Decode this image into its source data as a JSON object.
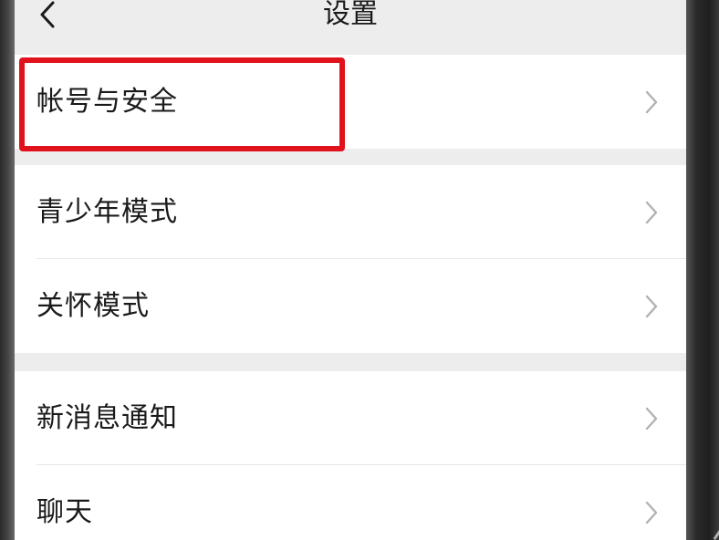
{
  "header": {
    "title": "设置",
    "back_icon": "chevron-left-icon"
  },
  "groups": [
    {
      "items": [
        {
          "label": "帐号与安全"
        }
      ]
    },
    {
      "items": [
        {
          "label": "青少年模式"
        },
        {
          "label": "关怀模式"
        }
      ]
    },
    {
      "items": [
        {
          "label": "新消息通知"
        },
        {
          "label": "聊天"
        }
      ]
    }
  ],
  "row_icon": "chevron-right-icon",
  "colors": {
    "background": "#ededed",
    "row": "#ffffff",
    "highlight": "#e0121b",
    "text": "#1a1a1a",
    "chevron": "#b2b2b2"
  }
}
